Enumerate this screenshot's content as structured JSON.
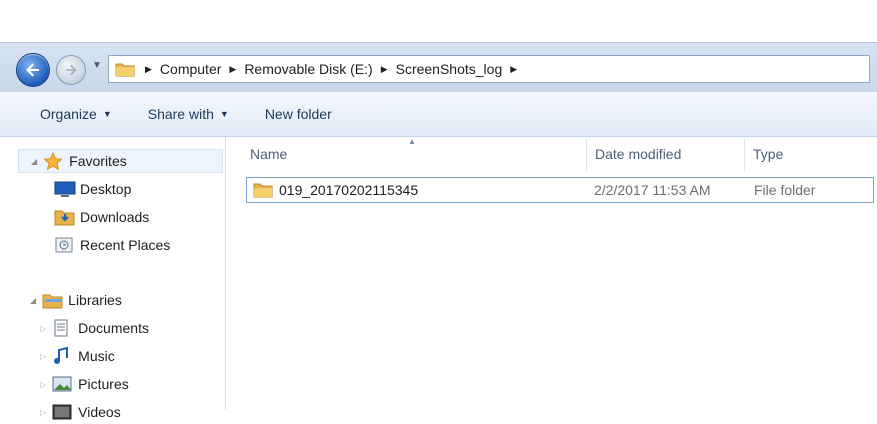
{
  "address_bar": {
    "breadcrumbs": [
      "Computer",
      "Removable Disk (E:)",
      "ScreenShots_log"
    ]
  },
  "toolbar": {
    "organize_label": "Organize",
    "share_with_label": "Share with",
    "new_folder_label": "New folder"
  },
  "nav_pane": {
    "favorites_label": "Favorites",
    "favorites_items": [
      "Desktop",
      "Downloads",
      "Recent Places"
    ],
    "libraries_label": "Libraries",
    "libraries_items": [
      "Documents",
      "Music",
      "Pictures",
      "Videos"
    ]
  },
  "file_list": {
    "columns": {
      "name": "Name",
      "date_modified": "Date modified",
      "type": "Type"
    },
    "rows": [
      {
        "name": "019_20170202115345",
        "date_modified": "2/2/2017 11:53 AM",
        "type": "File folder"
      }
    ]
  },
  "icons": {
    "back": "back-arrow-icon",
    "forward": "forward-arrow-icon",
    "folder": "folder-icon",
    "favorites": "star-icon",
    "libraries": "library-icon"
  },
  "colors": {
    "accent": "#1f5db8",
    "selection_border": "#7da2ce",
    "folder": "#e8b44a"
  }
}
